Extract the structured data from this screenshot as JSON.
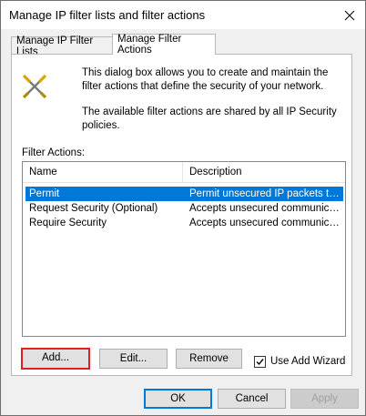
{
  "window": {
    "title": "Manage IP filter lists and filter actions"
  },
  "tabs": [
    {
      "label": "Manage IP Filter Lists"
    },
    {
      "label": "Manage Filter Actions"
    }
  ],
  "info": {
    "line1": "This dialog box allows you to create and maintain the filter actions that define the security of your network.",
    "line2": "The available filter actions are shared by all IP Security policies."
  },
  "list": {
    "section_label": "Filter Actions:",
    "columns": [
      "Name",
      "Description"
    ],
    "rows": [
      {
        "name": "Permit",
        "description": "Permit unsecured IP packets to ...",
        "selected": true
      },
      {
        "name": "Request Security (Optional)",
        "description": "Accepts unsecured communicati..."
      },
      {
        "name": "Require Security",
        "description": "Accepts unsecured communicati..."
      }
    ]
  },
  "actions": {
    "add": "Add...",
    "edit": "Edit...",
    "remove": "Remove",
    "wizard_label": "Use Add Wizard",
    "wizard_checked": true
  },
  "footer": {
    "ok": "OK",
    "cancel": "Cancel",
    "apply": "Apply"
  },
  "colors": {
    "selection": "#0078d7",
    "highlight_border": "#e02020"
  },
  "icons": {
    "info": "crossed-tools-icon",
    "close": "close-icon",
    "check": "checkmark-icon"
  }
}
